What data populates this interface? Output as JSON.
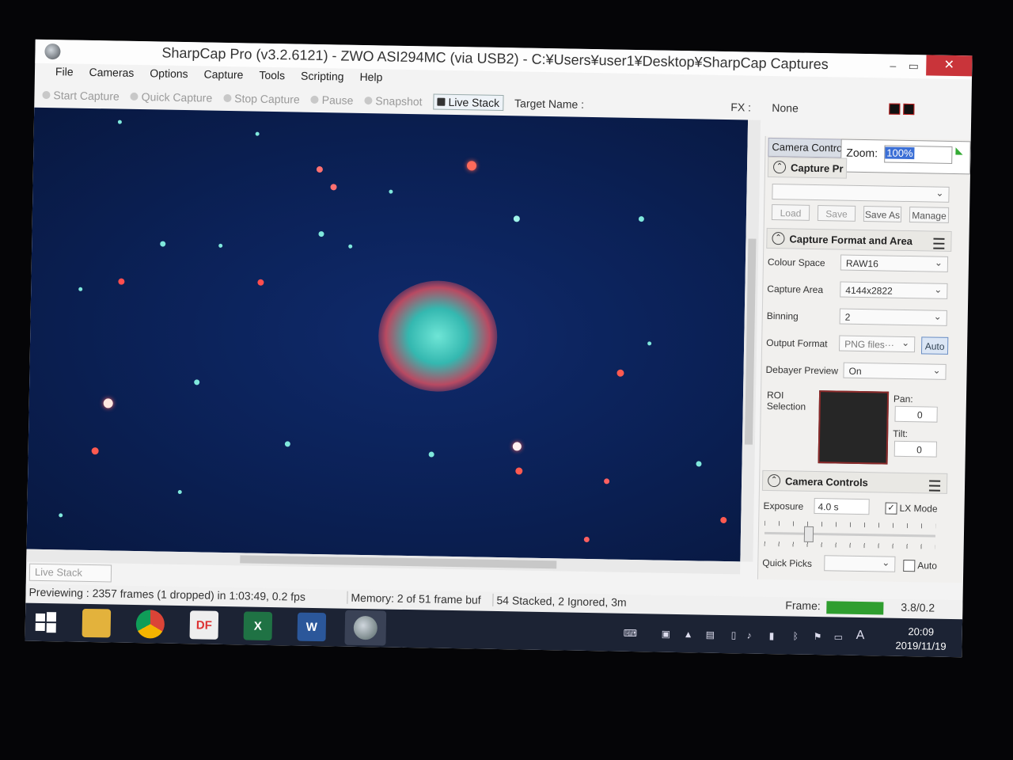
{
  "window": {
    "title": "SharpCap Pro (v3.2.6121) - ZWO ASI294MC (via USB2) - C:¥Users¥user1¥Desktop¥SharpCap Captures",
    "minimize": "–",
    "maximize": "▭",
    "close": "✕"
  },
  "menu": [
    "File",
    "Cameras",
    "Options",
    "Capture",
    "Tools",
    "Scripting",
    "Help"
  ],
  "toolbar": {
    "start_capture": "Start Capture",
    "quick_capture": "Quick Capture",
    "stop_capture": "Stop Capture",
    "pause": "Pause",
    "snapshot": "Snapshot",
    "live_stack": "Live Stack",
    "target_name": "Target Name :",
    "fx_label": "FX :",
    "fx_value": "None"
  },
  "panel": {
    "tab": "Camera Contro",
    "zoom_label": "Zoom:",
    "zoom_value": "100%",
    "capture_profiles": {
      "title": "Capture Pr",
      "load": "Load",
      "save": "Save",
      "save_as": "Save As",
      "manage": "Manage"
    },
    "capture_format": {
      "title": "Capture Format and Area",
      "colour_space_label": "Colour Space",
      "colour_space_value": "RAW16",
      "capture_area_label": "Capture Area",
      "capture_area_value": "4144x2822",
      "binning_label": "Binning",
      "binning_value": "2",
      "output_format_label": "Output Format",
      "output_format_value": "PNG files···",
      "auto": "Auto",
      "debayer_label": "Debayer Preview",
      "debayer_value": "On",
      "roi_label": "ROI\nSelection",
      "pan_label": "Pan:",
      "pan_value": "0",
      "tilt_label": "Tilt:",
      "tilt_value": "0"
    },
    "camera_controls": {
      "title": "Camera Controls",
      "exposure_label": "Exposure",
      "exposure_value": "4.0 s",
      "lx_mode": "LX Mode",
      "quick_picks": "Quick Picks",
      "auto": "Auto"
    }
  },
  "bottom_tab": "Live Stack",
  "status": {
    "previewing": "Previewing : 2357 frames (1 dropped) in 1:03:49, 0.2 fps",
    "memory": "Memory: 2 of 51 frame buf",
    "stacked": "54 Stacked, 2 Ignored, 3m",
    "frame_label": "Frame:",
    "frame_value": "3.8/0.2"
  },
  "taskbar": {
    "apps": [
      "windows-start",
      "file-explorer",
      "chrome",
      "pdf-app",
      "excel",
      "word",
      "sharpcap"
    ],
    "time": "20:09",
    "date": "2019/11/19",
    "ime": "A"
  },
  "colors": {
    "sky": "#0b2157",
    "close_button": "#c9343a",
    "frame_bar": "#2f9e2f",
    "taskbar": "#1c2334"
  }
}
